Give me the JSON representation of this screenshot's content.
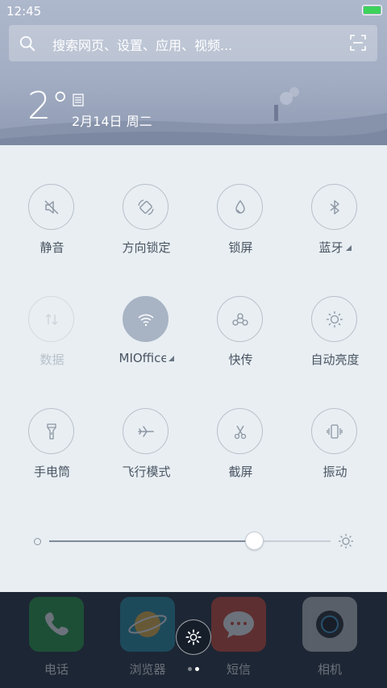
{
  "status": {
    "time": "12:45",
    "battery_level": 1.0,
    "battery_color": "#3cd35a"
  },
  "search": {
    "placeholder": "搜索网页、设置、应用、视频..."
  },
  "weather": {
    "temperature": "2°",
    "date": "2月14日 周二"
  },
  "tiles": [
    {
      "label": "静音",
      "icon": "mute-icon",
      "state": "off"
    },
    {
      "label": "方向锁定",
      "icon": "rotation-lock-icon",
      "state": "off"
    },
    {
      "label": "锁屏",
      "icon": "lock-screen-icon",
      "state": "off"
    },
    {
      "label": "蓝牙",
      "icon": "bluetooth-icon",
      "state": "off",
      "expandable": true
    },
    {
      "label": "数据",
      "icon": "mobile-data-icon",
      "state": "disabled"
    },
    {
      "label": "MIOffice",
      "icon": "wifi-icon",
      "state": "on",
      "expandable": true
    },
    {
      "label": "快传",
      "icon": "quick-share-icon",
      "state": "off"
    },
    {
      "label": "自动亮度",
      "icon": "auto-brightness-icon",
      "state": "off"
    },
    {
      "label": "手电筒",
      "icon": "flashlight-icon",
      "state": "off"
    },
    {
      "label": "飞行模式",
      "icon": "airplane-icon",
      "state": "off"
    },
    {
      "label": "截屏",
      "icon": "screenshot-icon",
      "state": "off"
    },
    {
      "label": "振动",
      "icon": "vibrate-icon",
      "state": "off"
    }
  ],
  "brightness": {
    "level": 0.73
  },
  "dock": [
    {
      "label": "电话",
      "icon": "phone-icon",
      "color": "#1f9c3a"
    },
    {
      "label": "浏览器",
      "icon": "browser-icon",
      "color": "#1f8ea3"
    },
    {
      "label": "短信",
      "icon": "messages-icon",
      "color": "#d8412e"
    },
    {
      "label": "相机",
      "icon": "camera-icon",
      "color": "#c9c9c9"
    }
  ],
  "colors": {
    "accent_active": "#a8b3c4",
    "panel_bg": "#e8eef2"
  }
}
